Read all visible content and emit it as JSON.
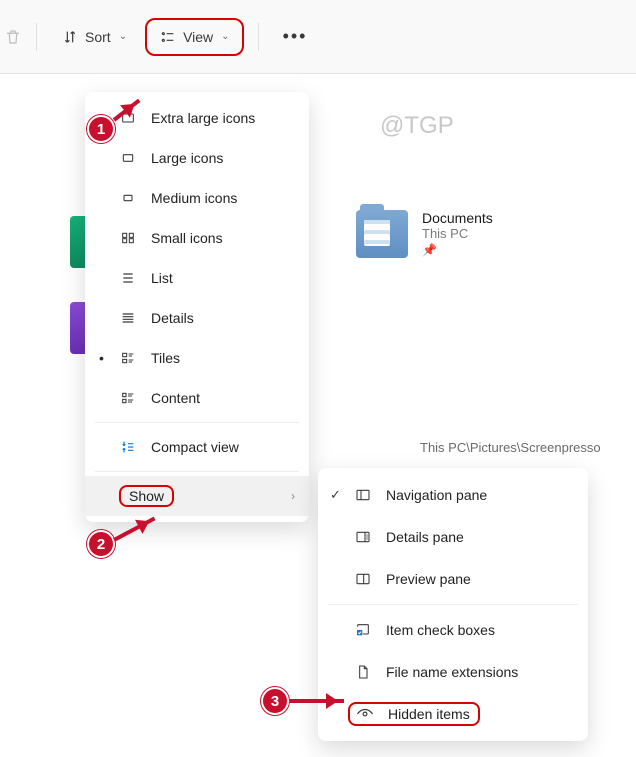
{
  "toolbar": {
    "sort_label": "Sort",
    "view_label": "View"
  },
  "watermark": "@TGP",
  "documents_tile": {
    "title": "Documents",
    "subtitle": "This PC"
  },
  "path_label": "This PC\\Pictures\\Screenpresso",
  "view_menu": {
    "items": [
      {
        "label": "Extra large icons"
      },
      {
        "label": "Large icons"
      },
      {
        "label": "Medium icons"
      },
      {
        "label": "Small icons"
      },
      {
        "label": "List"
      },
      {
        "label": "Details"
      },
      {
        "label": "Tiles",
        "selected": true
      },
      {
        "label": "Content"
      }
    ],
    "compact_label": "Compact view",
    "show_label": "Show"
  },
  "show_submenu": {
    "items": [
      {
        "label": "Navigation pane",
        "checked": true
      },
      {
        "label": "Details pane"
      },
      {
        "label": "Preview pane"
      }
    ],
    "item_check_boxes": "Item check boxes",
    "file_name_extensions": "File name extensions",
    "hidden_items": "Hidden items"
  },
  "annotations": {
    "one": "1",
    "two": "2",
    "three": "3"
  }
}
